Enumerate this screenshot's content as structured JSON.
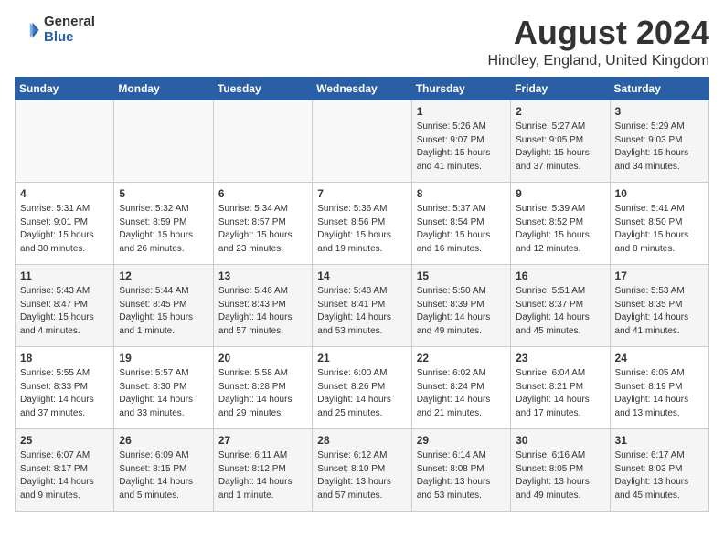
{
  "header": {
    "logo_general": "General",
    "logo_blue": "Blue",
    "title": "August 2024",
    "location": "Hindley, England, United Kingdom"
  },
  "calendar": {
    "days_of_week": [
      "Sunday",
      "Monday",
      "Tuesday",
      "Wednesday",
      "Thursday",
      "Friday",
      "Saturday"
    ],
    "weeks": [
      [
        {
          "day": "",
          "info": ""
        },
        {
          "day": "",
          "info": ""
        },
        {
          "day": "",
          "info": ""
        },
        {
          "day": "",
          "info": ""
        },
        {
          "day": "1",
          "info": "Sunrise: 5:26 AM\nSunset: 9:07 PM\nDaylight: 15 hours\nand 41 minutes."
        },
        {
          "day": "2",
          "info": "Sunrise: 5:27 AM\nSunset: 9:05 PM\nDaylight: 15 hours\nand 37 minutes."
        },
        {
          "day": "3",
          "info": "Sunrise: 5:29 AM\nSunset: 9:03 PM\nDaylight: 15 hours\nand 34 minutes."
        }
      ],
      [
        {
          "day": "4",
          "info": "Sunrise: 5:31 AM\nSunset: 9:01 PM\nDaylight: 15 hours\nand 30 minutes."
        },
        {
          "day": "5",
          "info": "Sunrise: 5:32 AM\nSunset: 8:59 PM\nDaylight: 15 hours\nand 26 minutes."
        },
        {
          "day": "6",
          "info": "Sunrise: 5:34 AM\nSunset: 8:57 PM\nDaylight: 15 hours\nand 23 minutes."
        },
        {
          "day": "7",
          "info": "Sunrise: 5:36 AM\nSunset: 8:56 PM\nDaylight: 15 hours\nand 19 minutes."
        },
        {
          "day": "8",
          "info": "Sunrise: 5:37 AM\nSunset: 8:54 PM\nDaylight: 15 hours\nand 16 minutes."
        },
        {
          "day": "9",
          "info": "Sunrise: 5:39 AM\nSunset: 8:52 PM\nDaylight: 15 hours\nand 12 minutes."
        },
        {
          "day": "10",
          "info": "Sunrise: 5:41 AM\nSunset: 8:50 PM\nDaylight: 15 hours\nand 8 minutes."
        }
      ],
      [
        {
          "day": "11",
          "info": "Sunrise: 5:43 AM\nSunset: 8:47 PM\nDaylight: 15 hours\nand 4 minutes."
        },
        {
          "day": "12",
          "info": "Sunrise: 5:44 AM\nSunset: 8:45 PM\nDaylight: 15 hours\nand 1 minute."
        },
        {
          "day": "13",
          "info": "Sunrise: 5:46 AM\nSunset: 8:43 PM\nDaylight: 14 hours\nand 57 minutes."
        },
        {
          "day": "14",
          "info": "Sunrise: 5:48 AM\nSunset: 8:41 PM\nDaylight: 14 hours\nand 53 minutes."
        },
        {
          "day": "15",
          "info": "Sunrise: 5:50 AM\nSunset: 8:39 PM\nDaylight: 14 hours\nand 49 minutes."
        },
        {
          "day": "16",
          "info": "Sunrise: 5:51 AM\nSunset: 8:37 PM\nDaylight: 14 hours\nand 45 minutes."
        },
        {
          "day": "17",
          "info": "Sunrise: 5:53 AM\nSunset: 8:35 PM\nDaylight: 14 hours\nand 41 minutes."
        }
      ],
      [
        {
          "day": "18",
          "info": "Sunrise: 5:55 AM\nSunset: 8:33 PM\nDaylight: 14 hours\nand 37 minutes."
        },
        {
          "day": "19",
          "info": "Sunrise: 5:57 AM\nSunset: 8:30 PM\nDaylight: 14 hours\nand 33 minutes."
        },
        {
          "day": "20",
          "info": "Sunrise: 5:58 AM\nSunset: 8:28 PM\nDaylight: 14 hours\nand 29 minutes."
        },
        {
          "day": "21",
          "info": "Sunrise: 6:00 AM\nSunset: 8:26 PM\nDaylight: 14 hours\nand 25 minutes."
        },
        {
          "day": "22",
          "info": "Sunrise: 6:02 AM\nSunset: 8:24 PM\nDaylight: 14 hours\nand 21 minutes."
        },
        {
          "day": "23",
          "info": "Sunrise: 6:04 AM\nSunset: 8:21 PM\nDaylight: 14 hours\nand 17 minutes."
        },
        {
          "day": "24",
          "info": "Sunrise: 6:05 AM\nSunset: 8:19 PM\nDaylight: 14 hours\nand 13 minutes."
        }
      ],
      [
        {
          "day": "25",
          "info": "Sunrise: 6:07 AM\nSunset: 8:17 PM\nDaylight: 14 hours\nand 9 minutes."
        },
        {
          "day": "26",
          "info": "Sunrise: 6:09 AM\nSunset: 8:15 PM\nDaylight: 14 hours\nand 5 minutes."
        },
        {
          "day": "27",
          "info": "Sunrise: 6:11 AM\nSunset: 8:12 PM\nDaylight: 14 hours\nand 1 minute."
        },
        {
          "day": "28",
          "info": "Sunrise: 6:12 AM\nSunset: 8:10 PM\nDaylight: 13 hours\nand 57 minutes."
        },
        {
          "day": "29",
          "info": "Sunrise: 6:14 AM\nSunset: 8:08 PM\nDaylight: 13 hours\nand 53 minutes."
        },
        {
          "day": "30",
          "info": "Sunrise: 6:16 AM\nSunset: 8:05 PM\nDaylight: 13 hours\nand 49 minutes."
        },
        {
          "day": "31",
          "info": "Sunrise: 6:17 AM\nSunset: 8:03 PM\nDaylight: 13 hours\nand 45 minutes."
        }
      ]
    ]
  }
}
